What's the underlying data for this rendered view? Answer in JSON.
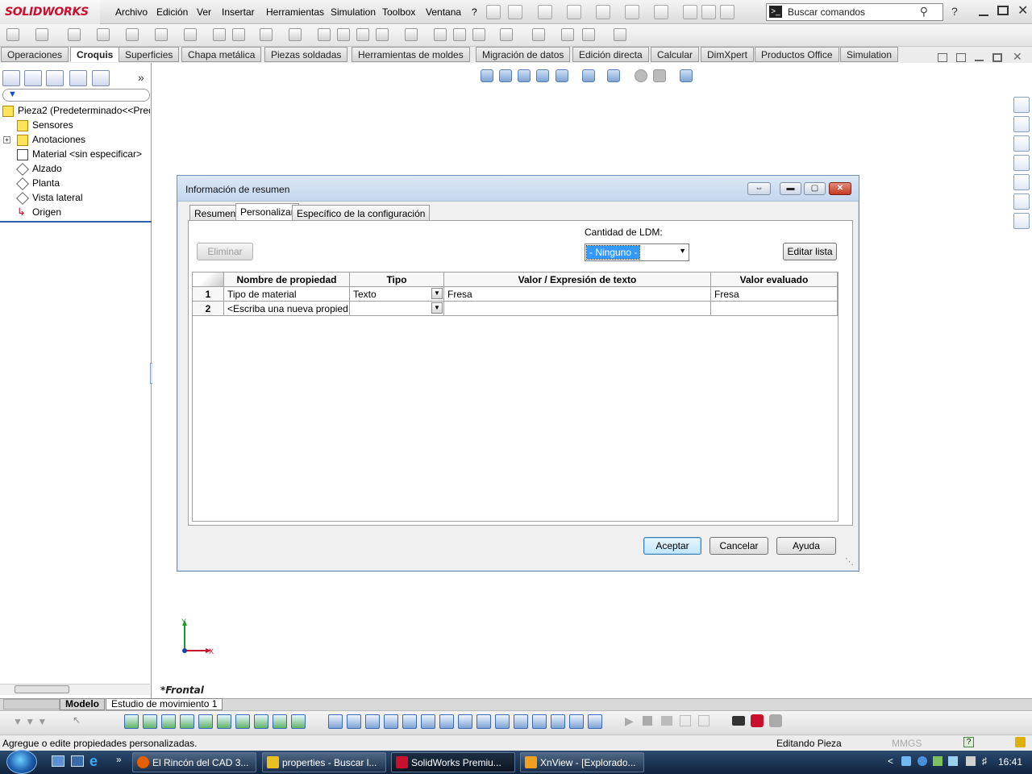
{
  "app": {
    "logo": "SOLIDWORKS",
    "menu": [
      "Archivo",
      "Edición",
      "Ver",
      "Insertar",
      "Herramientas",
      "Simulation",
      "Toolbox",
      "Ventana",
      "?"
    ],
    "search_placeholder": "Buscar comandos"
  },
  "command_tabs": [
    "Operaciones",
    "Croquis",
    "Superficies",
    "Chapa metálica",
    "Piezas soldadas",
    "Herramientas de moldes",
    "Migración de datos",
    "Edición directa",
    "Calcular",
    "DimXpert",
    "Productos Office",
    "Simulation"
  ],
  "active_command_tab": "Croquis",
  "feature_tree": {
    "root": "Pieza2  (Predeterminado<<Pred",
    "items": [
      "Sensores",
      "Anotaciones",
      "Material <sin especificar>",
      "Alzado",
      "Planta",
      "Vista lateral",
      "Origen"
    ]
  },
  "view": {
    "orientation_label": "*Frontal",
    "triad_x": "X",
    "triad_y": "Y"
  },
  "model_tabs": [
    "Modelo",
    "Estudio de movimiento 1"
  ],
  "status": {
    "message": "Agregue o edite propiedades personalizadas.",
    "mode": "Editando Pieza",
    "units": "MMGS"
  },
  "taskbar": {
    "tasks": [
      "El Rincón del CAD 3...",
      "properties - Buscar l...",
      "SolidWorks Premiu...",
      "XnView - [Explorado..."
    ],
    "clock": "16:41"
  },
  "dialog": {
    "title": "Información de resumen",
    "tabs": [
      "Resumen",
      "Personalizar",
      "Específico de la configuración"
    ],
    "active_tab": "Personalizar",
    "delete_button": "Eliminar",
    "bom_quantity_label": "Cantidad de LDM:",
    "bom_quantity_value": "- Ninguno -",
    "edit_list_button": "Editar lista",
    "columns": [
      "Nombre de propiedad",
      "Tipo",
      "Valor / Expresión de texto",
      "Valor evaluado"
    ],
    "rows": [
      {
        "num": "1",
        "name": "Tipo de material",
        "type": "Texto",
        "value": "Fresa",
        "evaluated": "Fresa"
      },
      {
        "num": "2",
        "name": "<Escriba una nueva propied",
        "type": "",
        "value": "",
        "evaluated": ""
      }
    ],
    "ok_button": "Aceptar",
    "cancel_button": "Cancelar",
    "help_button": "Ayuda"
  },
  "colors": {
    "accent": "#c8102e",
    "selection": "#3399ff",
    "dialog_title_bg": "#c5d7ee",
    "close_button": "#c23b22"
  }
}
